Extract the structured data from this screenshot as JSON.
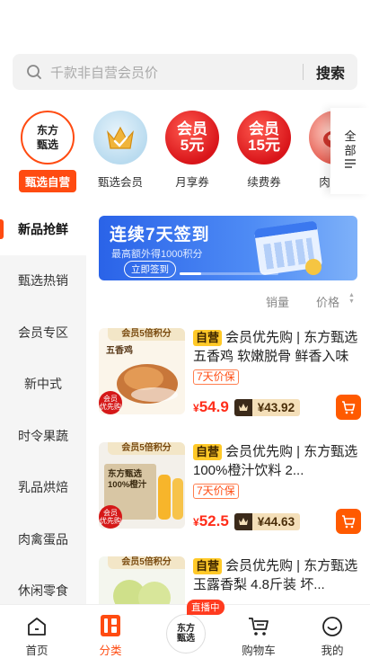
{
  "search": {
    "placeholder": "千款非自营会员价",
    "button": "搜索"
  },
  "categories": [
    {
      "label": "甄选自营",
      "icon": "dongfang-logo-icon",
      "active": true
    },
    {
      "label": "甄选会员",
      "icon": "vip-crown-icon"
    },
    {
      "label": "月享券",
      "icon": "coupon-icon",
      "line1": "会员",
      "line2": "5元"
    },
    {
      "label": "续费券",
      "icon": "coupon-icon",
      "line1": "会员",
      "line2": "15元"
    },
    {
      "label": "肉禽蛋",
      "icon": "meat-icon"
    }
  ],
  "all_categories": {
    "line1": "全",
    "line2": "部"
  },
  "sidebar": {
    "items": [
      {
        "label": "新品抢鲜",
        "active": true
      },
      {
        "label": "甄选热销"
      },
      {
        "label": "会员专区"
      },
      {
        "label": "新中式"
      },
      {
        "label": "时令果蔬"
      },
      {
        "label": "乳品烘焙"
      },
      {
        "label": "肉禽蛋品"
      },
      {
        "label": "休闲零食"
      }
    ]
  },
  "banner": {
    "title": "连续7天签到",
    "subtitle": "最高额外得1000积分",
    "button": "立即签到"
  },
  "sort": {
    "sales": "销量",
    "price": "价格"
  },
  "products": [
    {
      "img_tag": "会员5倍积分",
      "img_label": "五香鸡",
      "badge_zy": "自营",
      "title": "会员优先购 | 东方甄选五香鸡 软嫩脱骨 鲜香入味",
      "tag": "7天价保",
      "currency": "¥",
      "price": "54.9",
      "vip_price": "¥43.92"
    },
    {
      "img_tag": "会员5倍积分",
      "img_label": "东方甄选100%橙汁",
      "badge_zy": "自营",
      "title": "会员优先购 | 东方甄选100%橙汁饮料 2...",
      "tag": "7天价保",
      "currency": "¥",
      "price": "52.5",
      "vip_price": "¥44.63"
    },
    {
      "img_tag": "会员5倍积分",
      "img_label": "",
      "badge_zy": "自营",
      "title": "会员优先购 | 东方甄选玉露香梨 4.8斤装 坏...",
      "tag": "",
      "currency": "¥",
      "price": "",
      "vip_price": ""
    }
  ],
  "vip_badge": {
    "line1": "会员",
    "line2": "优先购"
  },
  "bottom_nav": {
    "home": "首页",
    "category": "分类",
    "live_badge": "直播中",
    "live_logo": "东方甄选",
    "cart": "购物车",
    "mine": "我的"
  },
  "colors": {
    "accent": "#ff4b11",
    "price": "#ff2d1a",
    "tag_yellow": "#ffc928"
  }
}
